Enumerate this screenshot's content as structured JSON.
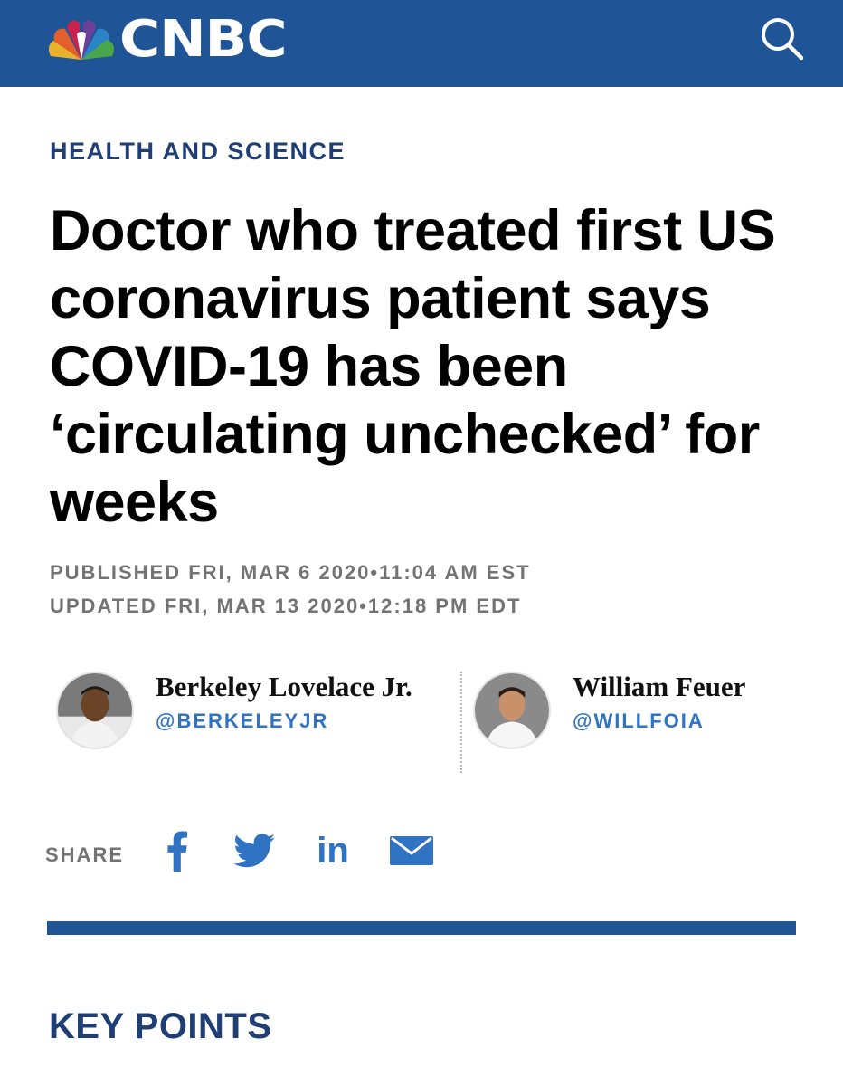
{
  "header": {
    "brand": "CNBC",
    "background_color": "#1f5596",
    "logo_icon": "peacock-icon",
    "search_icon": "search-icon"
  },
  "article": {
    "section": "HEALTH AND SCIENCE",
    "headline": "Doctor who treated first US coronavirus patient says COVID-19 has been ‘circulating unchecked’ for weeks",
    "published": "PUBLISHED FRI, MAR 6 2020•11:04 AM EST",
    "updated": "UPDATED FRI, MAR 13 2020•12:18 PM EDT"
  },
  "authors": [
    {
      "name": "Berkeley Lovelace Jr.",
      "handle": "@BERKELEYJR"
    },
    {
      "name": "William Feuer",
      "handle": "@WILLFOIA"
    }
  ],
  "share": {
    "label": "SHARE",
    "icons": [
      "facebook-icon",
      "twitter-icon",
      "linkedin-icon",
      "email-icon"
    ],
    "linkedin_text": "in",
    "icon_color": "#2f73c2"
  },
  "key_points": {
    "heading": "KEY POINTS"
  }
}
